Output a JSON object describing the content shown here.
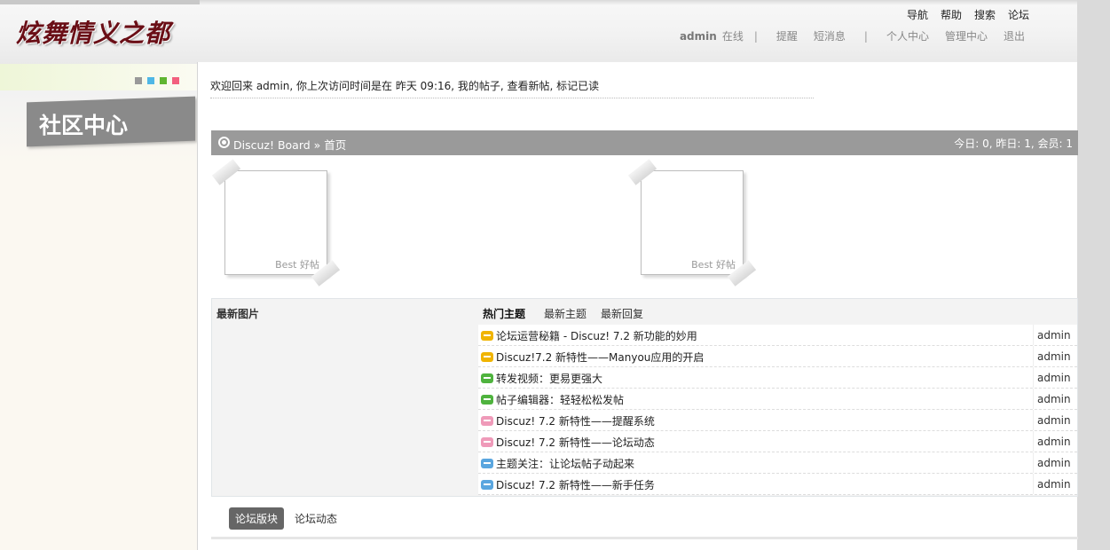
{
  "logo_text": "炫舞情义之都",
  "top_nav": [
    "导航",
    "帮助",
    "搜索",
    "论坛"
  ],
  "user_bar": {
    "username": "admin",
    "status": "在线",
    "links_a": [
      "提醒",
      "短消息"
    ],
    "links_b": [
      "个人中心",
      "管理中心",
      "退出"
    ],
    "separator": "|"
  },
  "sidebar": {
    "title": "社区中心",
    "dot_colors": [
      "#999999",
      "#4fb7e6",
      "#5fb531",
      "#f25f7e"
    ]
  },
  "welcome_text": "欢迎回来  admin, 你上次访问时间是在  昨天 09:16, 我的帖子, 查看新帖, 标记已读",
  "breadcrumb": {
    "path": "Discuz! Board » 首页",
    "stats": "今日: 0, 昨日: 1, 会员: 1"
  },
  "photos": [
    {
      "caption": "Best 好帖"
    },
    {
      "caption": "Best 好帖"
    }
  ],
  "latest_images_label": "最新图片",
  "thread_tabs": [
    "热门主题",
    "最新主题",
    "最新回复"
  ],
  "threads": [
    {
      "title": "论坛运营秘籍  - Discuz! 7.2 新功能的妙用",
      "author": "admin",
      "icon": "yellow-thread-icon",
      "color": "#f0b400"
    },
    {
      "title": "Discuz!7.2 新特性——Manyou应用的开启",
      "author": "admin",
      "icon": "yellow-thread-icon",
      "color": "#f0b400"
    },
    {
      "title": "转发视频：更易更强大",
      "author": "admin",
      "icon": "green-thread-icon",
      "color": "#4fb33e"
    },
    {
      "title": "帖子编辑器：轻轻松松发帖",
      "author": "admin",
      "icon": "green-thread-icon",
      "color": "#4fb33e"
    },
    {
      "title": "Discuz! 7.2 新特性——提醒系统",
      "author": "admin",
      "icon": "pink-thread-icon",
      "color": "#ef9ab9"
    },
    {
      "title": "Discuz! 7.2 新特性——论坛动态",
      "author": "admin",
      "icon": "pink-thread-icon",
      "color": "#ef9ab9"
    },
    {
      "title": "主题关注：让论坛帖子动起来",
      "author": "admin",
      "icon": "blue-thread-icon",
      "color": "#5aa6df"
    },
    {
      "title": "Discuz! 7.2 新特性——新手任务",
      "author": "admin",
      "icon": "blue-thread-icon",
      "color": "#5aa6df"
    }
  ],
  "bottom_tabs": [
    "论坛版块",
    "论坛动态"
  ]
}
